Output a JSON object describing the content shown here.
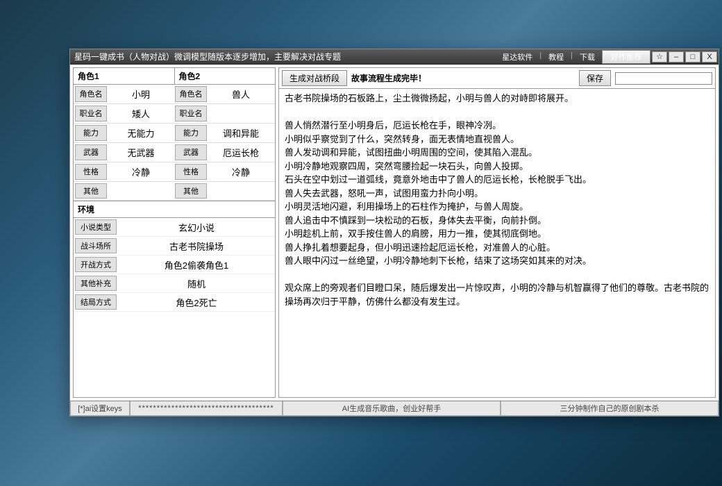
{
  "titlebar": {
    "title": "星码一键成书（人物对战）微调模型随版本逐步增加，主要解决对战专题",
    "links": [
      "星达软件",
      "教程",
      "下载"
    ],
    "rec": "好作推荐",
    "star": "☆",
    "min": "–",
    "max": "□",
    "close": "X"
  },
  "chars": {
    "header1": "角色1",
    "header2": "角色2",
    "rows": [
      {
        "lbl": "角色名",
        "v1": "小明",
        "v2": "兽人"
      },
      {
        "lbl": "职业名",
        "v1": "矮人",
        "v2": ""
      },
      {
        "lbl": "能力",
        "v1": "无能力",
        "v2": "调和异能"
      },
      {
        "lbl": "武器",
        "v1": "无武器",
        "v2": "厄运长枪"
      },
      {
        "lbl": "性格",
        "v1": "冷静",
        "v2": "冷静"
      },
      {
        "lbl": "其他",
        "v1": "",
        "v2": ""
      }
    ]
  },
  "env": {
    "header": "环境",
    "rows": [
      {
        "lbl": "小说类型",
        "val": "玄幻小说"
      },
      {
        "lbl": "战斗场所",
        "val": "古老书院操场"
      },
      {
        "lbl": "开战方式",
        "val": "角色2偷袭角色1"
      },
      {
        "lbl": "其他补充",
        "val": "随机"
      },
      {
        "lbl": "结局方式",
        "val": "角色2死亡"
      }
    ]
  },
  "rtool": {
    "gen": "生成对战桥段",
    "status": "故事流程生成完毕！",
    "save": "保存",
    "save_placeholder": ""
  },
  "story": "古老书院操场的石板路上，尘土微微扬起，小明与兽人的对峙即将展开。\n\n兽人悄然潜行至小明身后，厄运长枪在手，眼神冷冽。\n小明似乎察觉到了什么，突然转身，面无表情地直视兽人。\n兽人发动调和异能，试图扭曲小明周围的空间，使其陷入混乱。\n小明冷静地观察四周，突然弯腰捡起一块石头，向兽人投掷。\n石头在空中划过一道弧线，竟意外地击中了兽人的厄运长枪，长枪脱手飞出。\n兽人失去武器，怒吼一声，试图用蛮力扑向小明。\n小明灵活地闪避，利用操场上的石柱作为掩护，与兽人周旋。\n兽人追击中不慎踩到一块松动的石板，身体失去平衡，向前扑倒。\n小明趁机上前，双手按住兽人的肩膀，用力一推，使其彻底倒地。\n兽人挣扎着想要起身，但小明迅速捡起厄运长枪，对准兽人的心脏。\n兽人眼中闪过一丝绝望，小明冷静地刺下长枪，结束了这场突如其来的对决。\n\n观众席上的旁观者们目瞪口呆，随后爆发出一片惊叹声，小明的冷静与机智赢得了他们的尊敬。古老书院的操场再次归于平静，仿佛什么都没有发生过。",
  "bottom": {
    "keys": "[*]ai设置keys",
    "stars": "*************************************",
    "mid": "AI生成音乐歌曲，创业好帮手",
    "right": "三分钟制作自己的原创剧本杀"
  }
}
